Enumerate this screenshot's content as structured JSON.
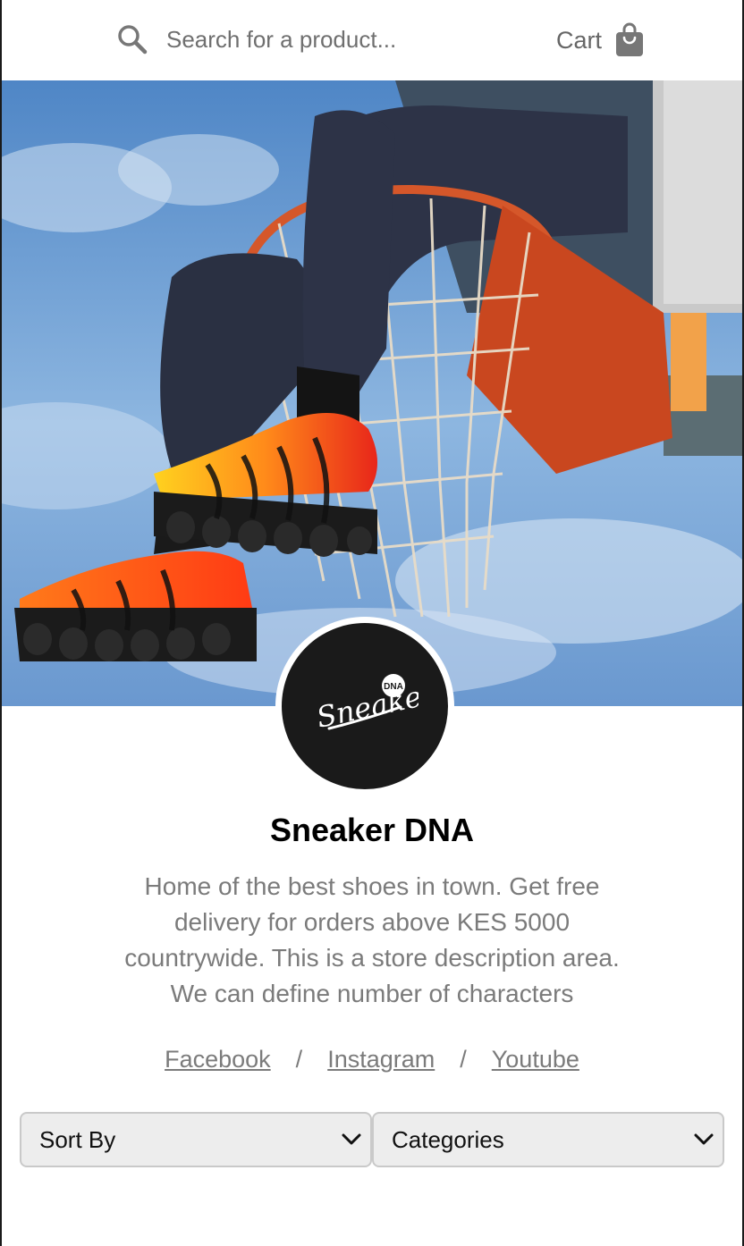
{
  "header": {
    "search_placeholder": "Search for a product...",
    "cart_label": "Cart",
    "icons": [
      "search-icon",
      "shopping-bag-icon"
    ]
  },
  "hero": {
    "image_alt": "Person sitting on a basketball hoop wearing orange and black sneakers"
  },
  "store": {
    "logo_text": "Sneaker",
    "logo_badge": "DNA",
    "name": "Sneaker DNA",
    "description": "Home of the best shoes in town. Get free delivery for orders above KES 5000 countrywide. This is a store description area. We can define number of characters"
  },
  "socials": {
    "links": [
      "Facebook",
      "Instagram",
      "Youtube"
    ],
    "separator": "/"
  },
  "filters": {
    "sort_label": "Sort By",
    "categories_label": "Categories"
  },
  "colors": {
    "accent_dark": "#1a1a1a",
    "muted_text": "#7b7b7b",
    "select_bg": "#ededed"
  }
}
